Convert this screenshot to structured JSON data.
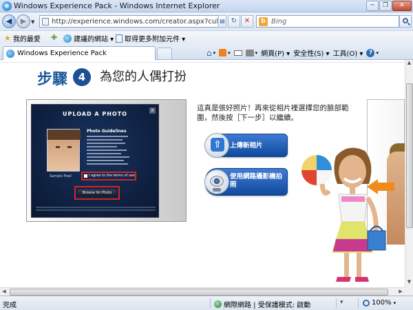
{
  "window": {
    "title": "Windows Experience Pack - Windows Internet Explorer",
    "minimize": "─",
    "restore": "❐",
    "close": "✕"
  },
  "address": {
    "url": "http://experience.windows.com/creator.aspx?culture",
    "search_placeholder": "Bing",
    "back": "◀",
    "forward": "▶",
    "refresh": "↻",
    "stop": "✕"
  },
  "favorites": {
    "favorites_label": "我的最愛",
    "suggested_sites": "建議的網站 ▾",
    "get_addons": "取得更多附加元件 ▾"
  },
  "tab": {
    "label": "Windows Experience Pack"
  },
  "command_bar": {
    "page": "網頁(P) ▾",
    "safety": "安全性(S) ▾",
    "tools": "工具(O) ▾",
    "help": "?"
  },
  "content": {
    "step_word": "步驟",
    "step_number": "4",
    "step_title": "為您的人偶打扮",
    "instruction": "這真是張好照片！再來從相片裡選擇您的臉部範圍，然後按［下一步］以繼續。",
    "upload_button": "上傳新相片",
    "webcam_button": "使用網路攝影機拍照",
    "preview": {
      "title": "UPLOAD A PHOTO",
      "guidelines": "Photo Guidelines",
      "sample_caption": "Sample Pixel",
      "agree": "I agree to the terms of use",
      "browse": "Browse for Photo",
      "close": "x"
    }
  },
  "status": {
    "text": "完成",
    "zone": "網際網路 | 受保護模式: 啟動",
    "zoom": "100%"
  }
}
